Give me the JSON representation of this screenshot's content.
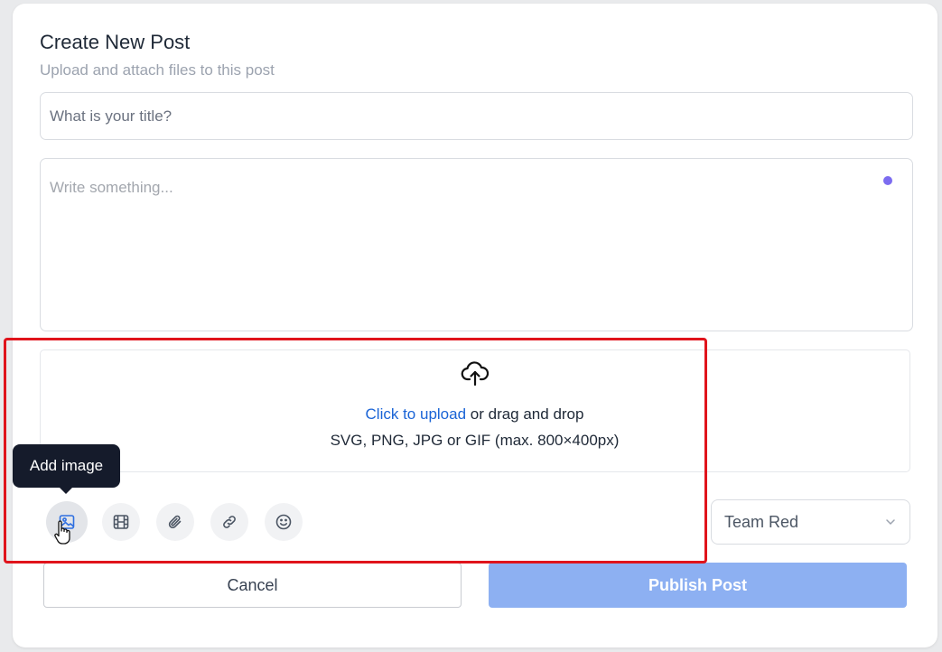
{
  "header": {
    "title": "Create New Post",
    "subtitle": "Upload and attach files to this post"
  },
  "form": {
    "title_placeholder": "What is your title?",
    "body_placeholder": "Write something..."
  },
  "upload": {
    "icon": "cloud-upload-icon",
    "link_text": "Click to upload",
    "rest_text": " or drag and drop",
    "hint": "SVG, PNG, JPG or GIF (max. 800×400px)"
  },
  "toolbar": {
    "tooltip": "Add image",
    "tools": [
      "image-icon",
      "film-icon",
      "paperclip-icon",
      "link-icon",
      "smiley-icon"
    ]
  },
  "team_select": {
    "value": "Team Red"
  },
  "actions": {
    "cancel_label": "Cancel",
    "publish_label": "Publish Post"
  },
  "colors": {
    "accent": "#1a64d6",
    "publish_bg": "#8db0f2",
    "highlight": "#e0141c",
    "dot": "#7c6cf0"
  }
}
